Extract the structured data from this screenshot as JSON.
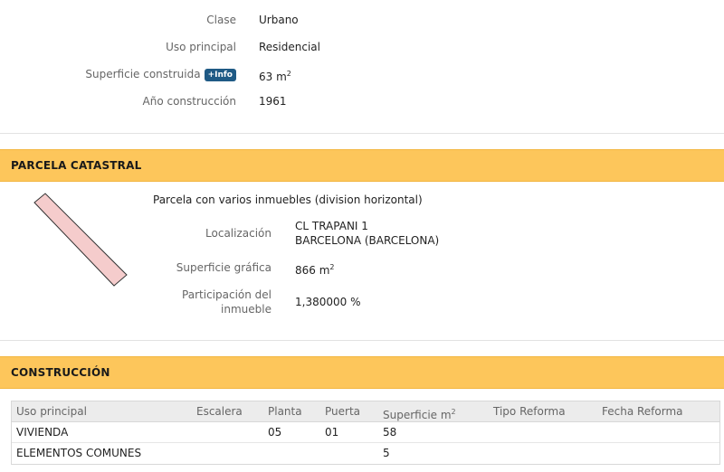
{
  "inmueble": {
    "clase_label": "Clase",
    "clase_value": "Urbano",
    "uso_label": "Uso principal",
    "uso_value": "Residencial",
    "superficie_label": "Superficie construida",
    "info_badge": "+Info",
    "superficie_value": "63 m",
    "superficie_unit_exp": "2",
    "anio_label": "Año construcción",
    "anio_value": "1961"
  },
  "parcela": {
    "title": "PARCELA CATASTRAL",
    "description": "Parcela con varios inmuebles (division horizontal)",
    "localizacion_label": "Localización",
    "localizacion_line1": "CL TRAPANI 1",
    "localizacion_line2": "BARCELONA (BARCELONA)",
    "superficie_label": "Superficie gráfica",
    "superficie_value": "866 m",
    "superficie_unit_exp": "2",
    "participacion_label_line1": "Participación del",
    "participacion_label_line2": "inmueble",
    "participacion_value": "1,380000 %",
    "shape_fill": "#f5cccc",
    "shape_stroke": "#333333"
  },
  "construccion": {
    "title": "CONSTRUCCIÓN",
    "headers": [
      "Uso principal",
      "Escalera",
      "Planta",
      "Puerta",
      "Superficie m",
      "Tipo Reforma",
      "Fecha Reforma"
    ],
    "header_superficie_exp": "2",
    "rows": [
      [
        "VIVIENDA",
        "",
        "05",
        "01",
        "58",
        "",
        ""
      ],
      [
        "ELEMENTOS COMUNES",
        "",
        "",
        "",
        "5",
        "",
        ""
      ]
    ]
  },
  "colors": {
    "section_bar": "#fdc65b",
    "info_badge": "#1f5a85"
  }
}
